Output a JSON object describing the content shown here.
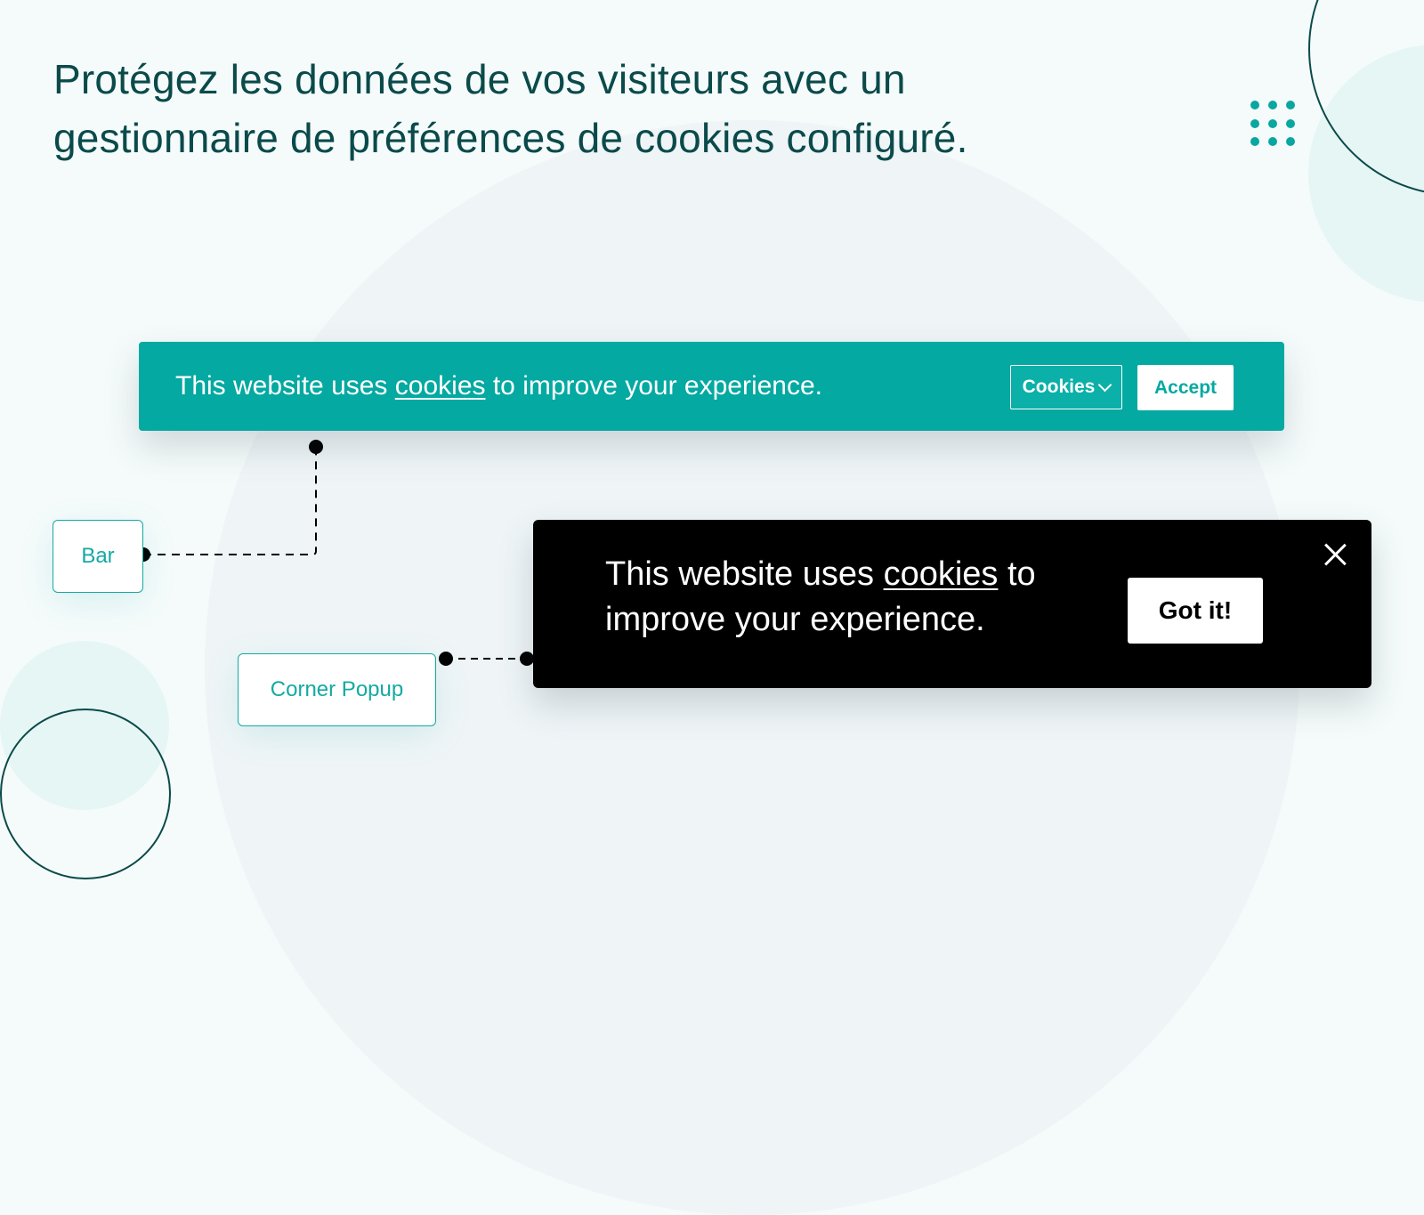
{
  "headline": "Protégez les données de vos visiteurs avec un gestionnaire de préférences de cookies configuré.",
  "colors": {
    "accent": "#04a9a1",
    "heading": "#0b4a4a",
    "background": "#f5fbfb",
    "popup_bg": "#000000"
  },
  "bar_banner": {
    "text_before": "This website uses ",
    "link": "cookies",
    "text_after": " to improve your experience.",
    "cookies_dropdown": {
      "label": "Cookies",
      "icon": "chevron-down-icon"
    },
    "accept_label": "Accept"
  },
  "popup_banner": {
    "text_before": "This website uses ",
    "link": "cookies",
    "text_after": " to improve your experience.",
    "button_label": "Got it!",
    "close_icon": "close-icon"
  },
  "labels": {
    "bar": "Bar",
    "corner_popup": "Corner Popup"
  }
}
